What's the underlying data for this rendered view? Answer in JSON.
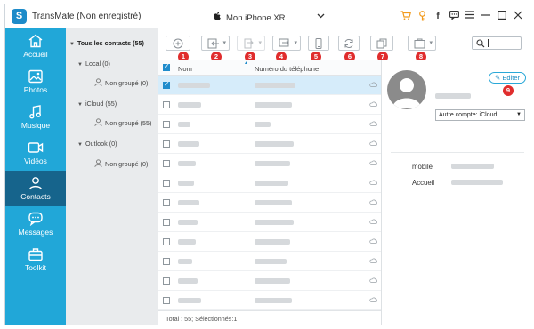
{
  "app": {
    "title": "TransMate (Non enregistré)",
    "device": "Mon iPhone XR",
    "logo_letter": "S"
  },
  "titlebar_icons": [
    "cart-icon",
    "key-icon",
    "facebook-icon",
    "chat-icon",
    "menu-icon",
    "minimize-icon",
    "maximize-icon",
    "close-icon"
  ],
  "sidebar": {
    "items": [
      {
        "label": "Accueil",
        "icon": "home-icon"
      },
      {
        "label": "Photos",
        "icon": "photos-icon"
      },
      {
        "label": "Musique",
        "icon": "music-icon"
      },
      {
        "label": "Vidéos",
        "icon": "video-icon"
      },
      {
        "label": "Contacts",
        "icon": "contacts-icon",
        "active": true
      },
      {
        "label": "Messages",
        "icon": "messages-icon"
      },
      {
        "label": "Toolkit",
        "icon": "toolkit-icon"
      }
    ]
  },
  "tree": {
    "all": "Tous les contacts  (55)",
    "local": "Local  (0)",
    "local_ungrouped": "Non groupé  (0)",
    "icloud": "iCloud  (55)",
    "icloud_ungrouped": "Non groupé  (55)",
    "outlook": "Outlook  (0)",
    "outlook_ungrouped": "Non groupé  (0)"
  },
  "toolbar": {
    "badges": [
      "1",
      "2",
      "3",
      "4",
      "5",
      "6",
      "7",
      "8"
    ],
    "tools": [
      "add-contact",
      "import",
      "export",
      "transfer-to-device",
      "backup",
      "refresh",
      "duplicate",
      "groups"
    ],
    "edit_badge": "9"
  },
  "list": {
    "col_name": "Nom",
    "col_phone": "Numéro du téléphone",
    "rows": [
      {
        "selected": true
      },
      {},
      {},
      {},
      {},
      {},
      {},
      {},
      {},
      {},
      {},
      {}
    ]
  },
  "status": {
    "text": "Total : 55; Sélectionnés:1"
  },
  "detail": {
    "edit_label": "Editer",
    "account_select": "Autre compte: iCloud",
    "mobile_label": "mobile",
    "home_label": "Accueil"
  },
  "colors": {
    "sidebar": "#21a7d8",
    "sidebar_active": "#16648c",
    "accent": "#1f8ccc",
    "badge": "#e02d2d"
  }
}
